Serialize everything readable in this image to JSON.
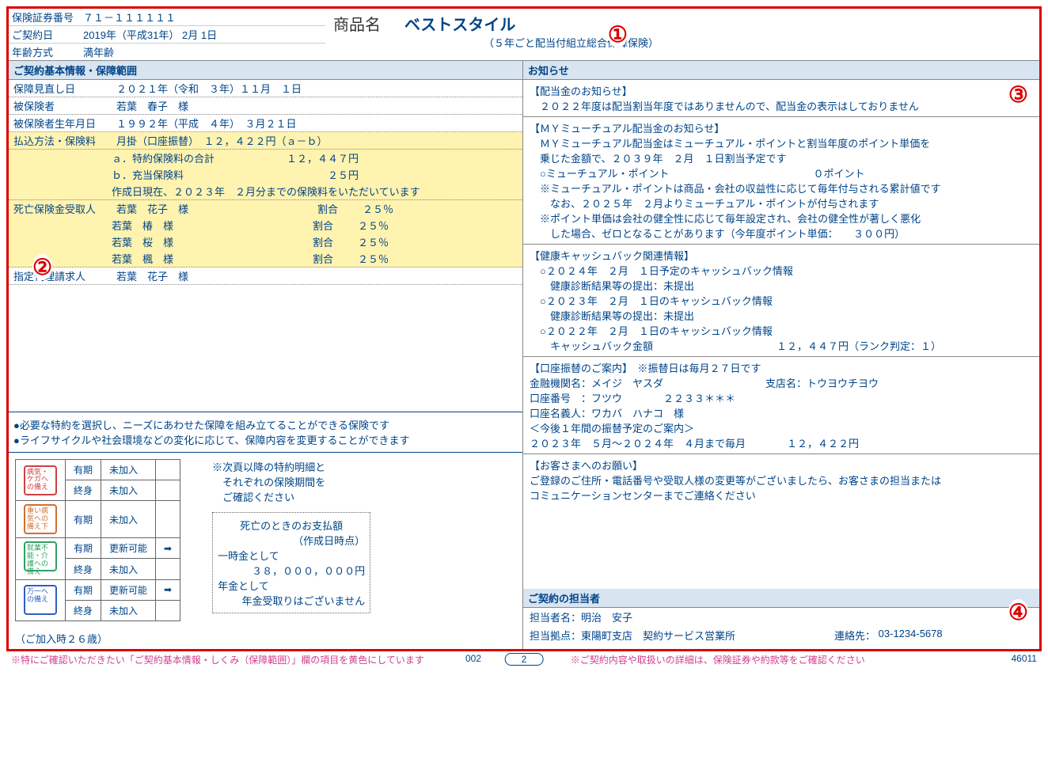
{
  "header": {
    "policy_no_label": "保険証券番号",
    "policy_no": "７１－１１１１１１",
    "contract_date_label": "ご契約日",
    "contract_date": "2019年（平成31年） 2月 1日",
    "age_method_label": "年齢方式",
    "age_method": "満年齢",
    "product_label": "商品名",
    "product_name": "ベストスタイル",
    "product_sub": "（５年ごと配当付組立総合保障保険）"
  },
  "basic": {
    "section": "ご契約基本情報・保障範囲",
    "review_label": "保障見直し日",
    "review_date": "２０２１年（令和　３年）１１月　１日",
    "insured_label": "被保険者",
    "insured": "若葉　春子　様",
    "dob_label": "被保険者生年月日",
    "dob": "１９９２年（平成　４年）　３月２１日",
    "pay_label": "払込方法・保険料",
    "pay_val": "月掛（口座振替）　１２，４２２円（ａ－ｂ）",
    "pay_a": "ａ．特約保険料の合計　　　　　　　１２，４４７円",
    "pay_b": "ｂ．充当保険料　　　　　　　　　　　　　　２５円",
    "pay_note": "作成日現在、２０２３年　２月分までの保険料をいただいています",
    "death_label": "死亡保険金受取人",
    "ben": [
      {
        "name": "若葉　花子　様",
        "ratio_l": "割合",
        "ratio": "２５％"
      },
      {
        "name": "若葉　椿　様",
        "ratio_l": "割合",
        "ratio": "２５％"
      },
      {
        "name": "若葉　桜　様",
        "ratio_l": "割合",
        "ratio": "２５％"
      },
      {
        "name": "若葉　楓　様",
        "ratio_l": "割合",
        "ratio": "２５％"
      }
    ],
    "proxy_label": "指定代理請求人",
    "proxy": "若葉　花子　様"
  },
  "notes": {
    "n1": "●必要な特約を選択し、ニーズにあわせた保障を組み立てることができる保険です",
    "n2": "●ライフサイクルや社会環境などの変化に応じて、保障内容を変更することができます"
  },
  "riders": {
    "note1": "※次頁以降の特約明細と",
    "note2": "　それぞれの保険期間を",
    "note3": "　ご確認ください",
    "rows": [
      {
        "icon": "病気・ケガへの備え",
        "cls": "ic-red",
        "term": "有期",
        "status": "未加入",
        "arrow": ""
      },
      {
        "icon": "",
        "cls": "",
        "term": "終身",
        "status": "未加入",
        "arrow": ""
      },
      {
        "icon": "重い病気への備え下",
        "cls": "ic-org",
        "term": "有期",
        "status": "未加入",
        "arrow": ""
      },
      {
        "icon": "就業不能・介護への備え",
        "cls": "ic-grn",
        "term": "有期",
        "status": "更新可能",
        "arrow": "➡"
      },
      {
        "icon": "",
        "cls": "",
        "term": "終身",
        "status": "未加入",
        "arrow": ""
      },
      {
        "icon": "万一への備え",
        "cls": "ic-blu",
        "term": "有期",
        "status": "更新可能",
        "arrow": "➡"
      },
      {
        "icon": "",
        "cls": "",
        "term": "終身",
        "status": "未加入",
        "arrow": ""
      }
    ],
    "payout_title": "死亡のときのお支払額",
    "payout_sub": "（作成日時点）",
    "lump_l": "一時金として",
    "lump_v": "３８，０００，０００円",
    "ann_l": "年金として",
    "ann_v": "年金受取りはございません"
  },
  "age_note": "（ご加入時２６歳）",
  "notice": {
    "section": "お知らせ",
    "div_title": "【配当金のお知らせ】",
    "div_text": "　２０２２年度は配当割当年度ではありませんので、配当金の表示はしておりません",
    "my_title": "【ＭＹミューチュアル配当金のお知らせ】",
    "my_1": "　ＭＹミューチュアル配当金はミューチュアル・ポイントと割当年度のポイント単価を",
    "my_2": "　乗じた金額で、２０３９年　２月　１日割当予定です",
    "my_3": "　○ミューチュアル・ポイント　　　　　　　　　　　　　　０ポイント",
    "my_4": "　※ミューチュアル・ポイントは商品・会社の収益性に応じて毎年付与される累計値です",
    "my_5": "　　なお、２０２５年　２月よりミューチュアル・ポイントが付与されます",
    "my_6": "　※ポイント単価は会社の健全性に応じて毎年設定され、会社の健全性が著しく悪化",
    "my_7": "　　した場合、ゼロとなることがあります（今年度ポイント単価：　　３００円）",
    "cb_title": "【健康キャッシュバック関連情報】",
    "cb_1": "　○２０２４年　２月　１日予定のキャッシュバック情報",
    "cb_2": "　　健康診断結果等の提出：未提出",
    "cb_3": "　○２０２３年　２月　１日のキャッシュバック情報",
    "cb_4": "　　健康診断結果等の提出：未提出",
    "cb_5": "　○２０２２年　２月　１日のキャッシュバック情報",
    "cb_6": "　　キャッシュバック金額　　　　　　　　　　　　１２，４４７円（ランク判定：１）",
    "bank_title": "【口座振替のご案内】　※振替日は毎月２７日です",
    "bank_inst_l": "金融機関名：",
    "bank_inst": "メイジ　ヤスダ",
    "bank_branch_l": "支店名：",
    "bank_branch": "トウヨウチヨウ",
    "bank_acct_l": "口座番号　：",
    "bank_acct": "フツウ　　　　２２３３＊＊＊",
    "bank_holder_l": "口座名義人：",
    "bank_holder": "ワカバ　ハナコ　様",
    "bank_sched_t": "＜今後１年間の振替予定のご案内＞",
    "bank_sched": "２０２３年　５月～２０２４年　４月まで毎月　　　　１２，４２２円",
    "req_title": "【お客さまへのお願い】",
    "req_1": "ご登録のご住所・電話番号や受取人様の変更等がございましたら、お客さまの担当または",
    "req_2": "コミュニケーションセンターまでご連絡ください"
  },
  "agent": {
    "section": "ご契約の担当者",
    "name_l": "担当者名：",
    "name": "明治　安子",
    "office_l": "担当拠点：",
    "office": "東陽町支店　契約サービス営業所",
    "tel_l": "連絡先：",
    "tel": "03-1234-5678"
  },
  "footer": {
    "left": "※特にご確認いただきたい「ご契約基本情報・しくみ（保障範囲）」欄の項目を黄色にしています",
    "center_num": "002",
    "page": "2",
    "right": "※ご契約内容や取扱いの詳細は、保険証券や約款等をご確認ください",
    "code": "46011"
  },
  "markers": {
    "m1": "①",
    "m2": "②",
    "m3": "③",
    "m4": "④"
  }
}
